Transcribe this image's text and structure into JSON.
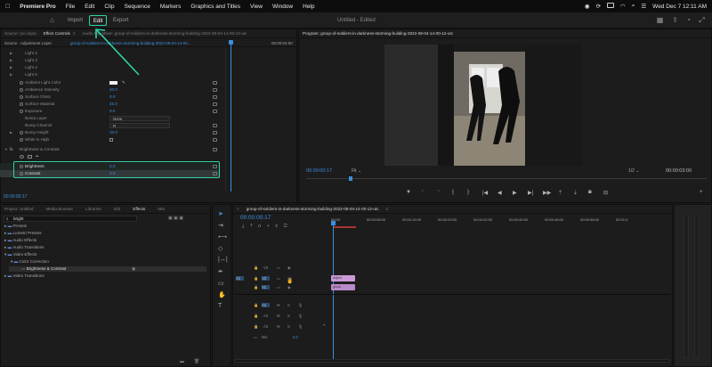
{
  "menubar": {
    "app": "Premiere Pro",
    "items": [
      "File",
      "Edit",
      "Clip",
      "Sequence",
      "Markers",
      "Graphics and Titles",
      "View",
      "Window",
      "Help"
    ],
    "datetime": "Wed Dec 7  12:11 AM"
  },
  "header": {
    "tabs": [
      "Import",
      "Edit",
      "Export"
    ],
    "active_tab": "Edit",
    "doc_title": "Untitled - Edited"
  },
  "source_panel": {
    "tabs": [
      "Source: (no clips)",
      "Effect Controls",
      "Audio Clip Mixer: group-of-soldiers-in-darkness-storming-building-2022-08-04-14-00-12-utc"
    ],
    "active_tab": "Effect Controls",
    "source_line": "Source · Adjustment Layer",
    "sequence_name": "group-of-soldiers-in-darkness-storming-building-2022-08-04-14-00...",
    "ruler_time": "00:00:04:00",
    "rows": [
      {
        "label": "Light 2",
        "value": ""
      },
      {
        "label": "Light 3",
        "value": ""
      },
      {
        "label": "Light 4",
        "value": ""
      },
      {
        "label": "Light 5",
        "value": ""
      },
      {
        "label": "Ambient Light Color",
        "value": ""
      },
      {
        "label": "Ambience Intensity",
        "value": "20.0"
      },
      {
        "label": "Surface Gloss",
        "value": "0.0"
      },
      {
        "label": "Surface Material",
        "value": "45.0"
      },
      {
        "label": "Exposure",
        "value": "0.0"
      },
      {
        "label": "Bump Layer",
        "value": "None"
      },
      {
        "label": "Bump Channel",
        "value": "R"
      },
      {
        "label": "Bump Height",
        "value": "10.0"
      },
      {
        "label": "White is High",
        "value": ""
      },
      {
        "label": "Brightness & Contrast",
        "value": ""
      },
      {
        "label": "Brightness",
        "value": "0.0"
      },
      {
        "label": "Contrast",
        "value": "0.0"
      }
    ],
    "timecode": "00:00:00:17"
  },
  "program_panel": {
    "title": "Program: group-of-soldiers-in-darkness-storming-building-2022-08-04-14-00-12-utc",
    "timecode": "00:00:00:17",
    "fit": "Fit",
    "ratio": "1/2",
    "duration": "00:00:03:00"
  },
  "effects_panel": {
    "tabs": [
      "Project: Untitled",
      "Media Browser",
      "Libraries",
      "Info",
      "Effects",
      "Mar"
    ],
    "active_tab": "Effects",
    "search_value": "bright",
    "tree": [
      {
        "label": "Presets",
        "indent": 0
      },
      {
        "label": "Lumetri Presets",
        "indent": 0
      },
      {
        "label": "Audio Effects",
        "indent": 0
      },
      {
        "label": "Audio Transitions",
        "indent": 0
      },
      {
        "label": "Video Effects",
        "indent": 0
      },
      {
        "label": "Color Correction",
        "indent": 1
      },
      {
        "label": "Brightness & Contrast",
        "indent": 2
      },
      {
        "label": "Video Transitions",
        "indent": 0
      }
    ]
  },
  "timeline": {
    "tab": "group-of-soldiers-in-darkness-storming-building-2022-08-04-14-00-12-utc",
    "timecode": "00:00:00:17",
    "ruler": [
      "00:00",
      "00:00:08:00",
      "00:00:16:00",
      "00:00:24:00",
      "00:00:32:00",
      "00:00:40:00",
      "00:00:48:00",
      "00:00:56:00",
      "00:01:0"
    ],
    "video_tracks": [
      "V3",
      "V2",
      "V1"
    ],
    "audio_tracks": [
      "A1",
      "A2",
      "A3"
    ],
    "mix_label": "Mix",
    "mix_value": "0.0",
    "clips": [
      {
        "label": "Adjust",
        "track": "V2"
      },
      {
        "label": "group",
        "track": "V1"
      }
    ]
  },
  "colors": {
    "highlight": "#2fd3a6",
    "timecode": "#3d8fe0",
    "clip": "#c99ad6"
  }
}
